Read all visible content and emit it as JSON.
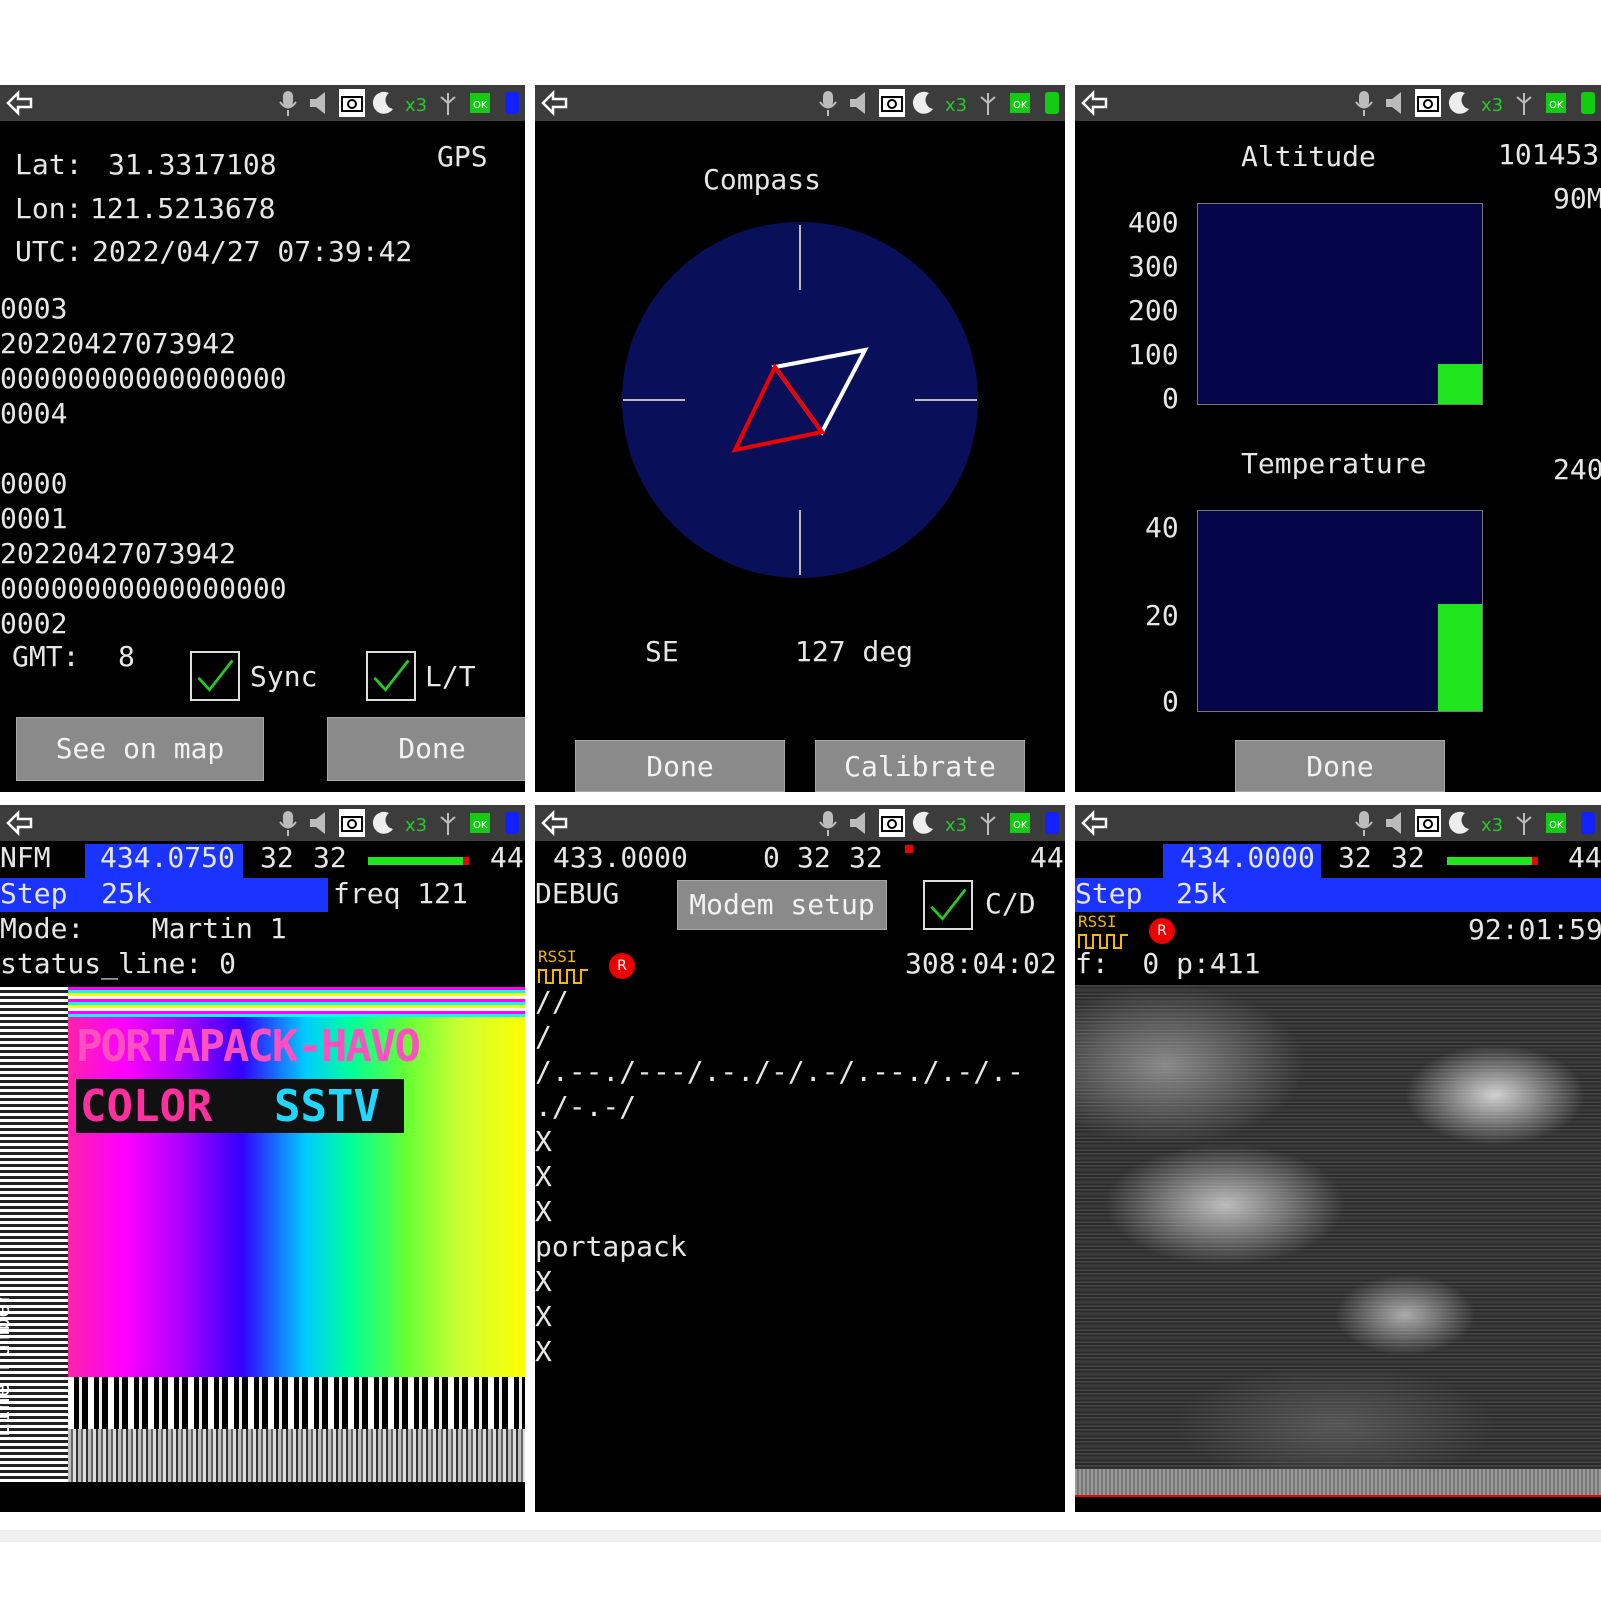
{
  "status_icons": [
    "back-arrow-icon",
    "microphone-icon",
    "speaker-icon",
    "camera-icon",
    "moon-icon",
    "clock-icon",
    "antenna-icon",
    "sd-card-icon",
    "battery-icon"
  ],
  "gps": {
    "lat_label": "Lat:",
    "lat_value": "31.3317108",
    "lon_label": "Lon:",
    "lon_value": "121.5213678",
    "utc_label": "UTC:",
    "utc_value": "2022/04/27 07:39:42",
    "source": "GPS",
    "log_lines": [
      "0003",
      "20220427073942",
      "00000000000000000",
      "0004",
      "",
      "0000",
      "0001",
      "20220427073942",
      "00000000000000000",
      "0002"
    ],
    "gmt_label": "GMT:",
    "gmt_value": "8",
    "sync_label": "Sync",
    "lt_label": "L/T",
    "see_on_map": "See on map",
    "done": "Done"
  },
  "compass": {
    "title": "Compass",
    "direction": "SE",
    "degrees": "127 deg",
    "done": "Done",
    "calibrate": "Calibrate"
  },
  "altitude": {
    "title": "Altitude",
    "value1": "101453",
    "value2": "90M",
    "ticks": [
      "400",
      "300",
      "200",
      "100",
      "0"
    ],
    "level": 90
  },
  "temperature": {
    "title": "Temperature",
    "value": "240",
    "ticks": [
      "40",
      "20",
      "0"
    ],
    "level": 24,
    "done": "Done"
  },
  "sstv": {
    "mode_label": "NFM",
    "freq": "434.0750",
    "lna": "32",
    "vga": "32",
    "vol": "44",
    "step": "Step  25k",
    "freq_info": "freq 121",
    "mode_line": "Mode:    Martin 1",
    "status_line": "status_line: 0",
    "image_text_1": "PORTAPACK-HAVO",
    "image_text_2a": "COLOR",
    "image_text_2b": "SSTV",
    "side_label": "Line number"
  },
  "morse": {
    "freq": "433.0000",
    "amp": "0",
    "lna": "32",
    "vga": "32",
    "vol": "44",
    "debug": "DEBUG",
    "modem_setup": "Modem setup",
    "cd_label": "C/D",
    "rssi": "RSSI",
    "rec": "R",
    "timer": "308:04:02",
    "lines": [
      "//",
      "/",
      "/.--./---/.-./-/.-/.--./.-/.-",
      "./-.-/",
      "X",
      "X",
      "X",
      "portapack",
      "X",
      "X",
      "X"
    ]
  },
  "weather": {
    "freq": "434.0000",
    "lna": "32",
    "vga": "32",
    "vol": "44",
    "step": "Step  25k",
    "rssi": "RSSI",
    "rec": "R",
    "timer": "92:01:59",
    "fp_line": "f:  0 p:411"
  }
}
